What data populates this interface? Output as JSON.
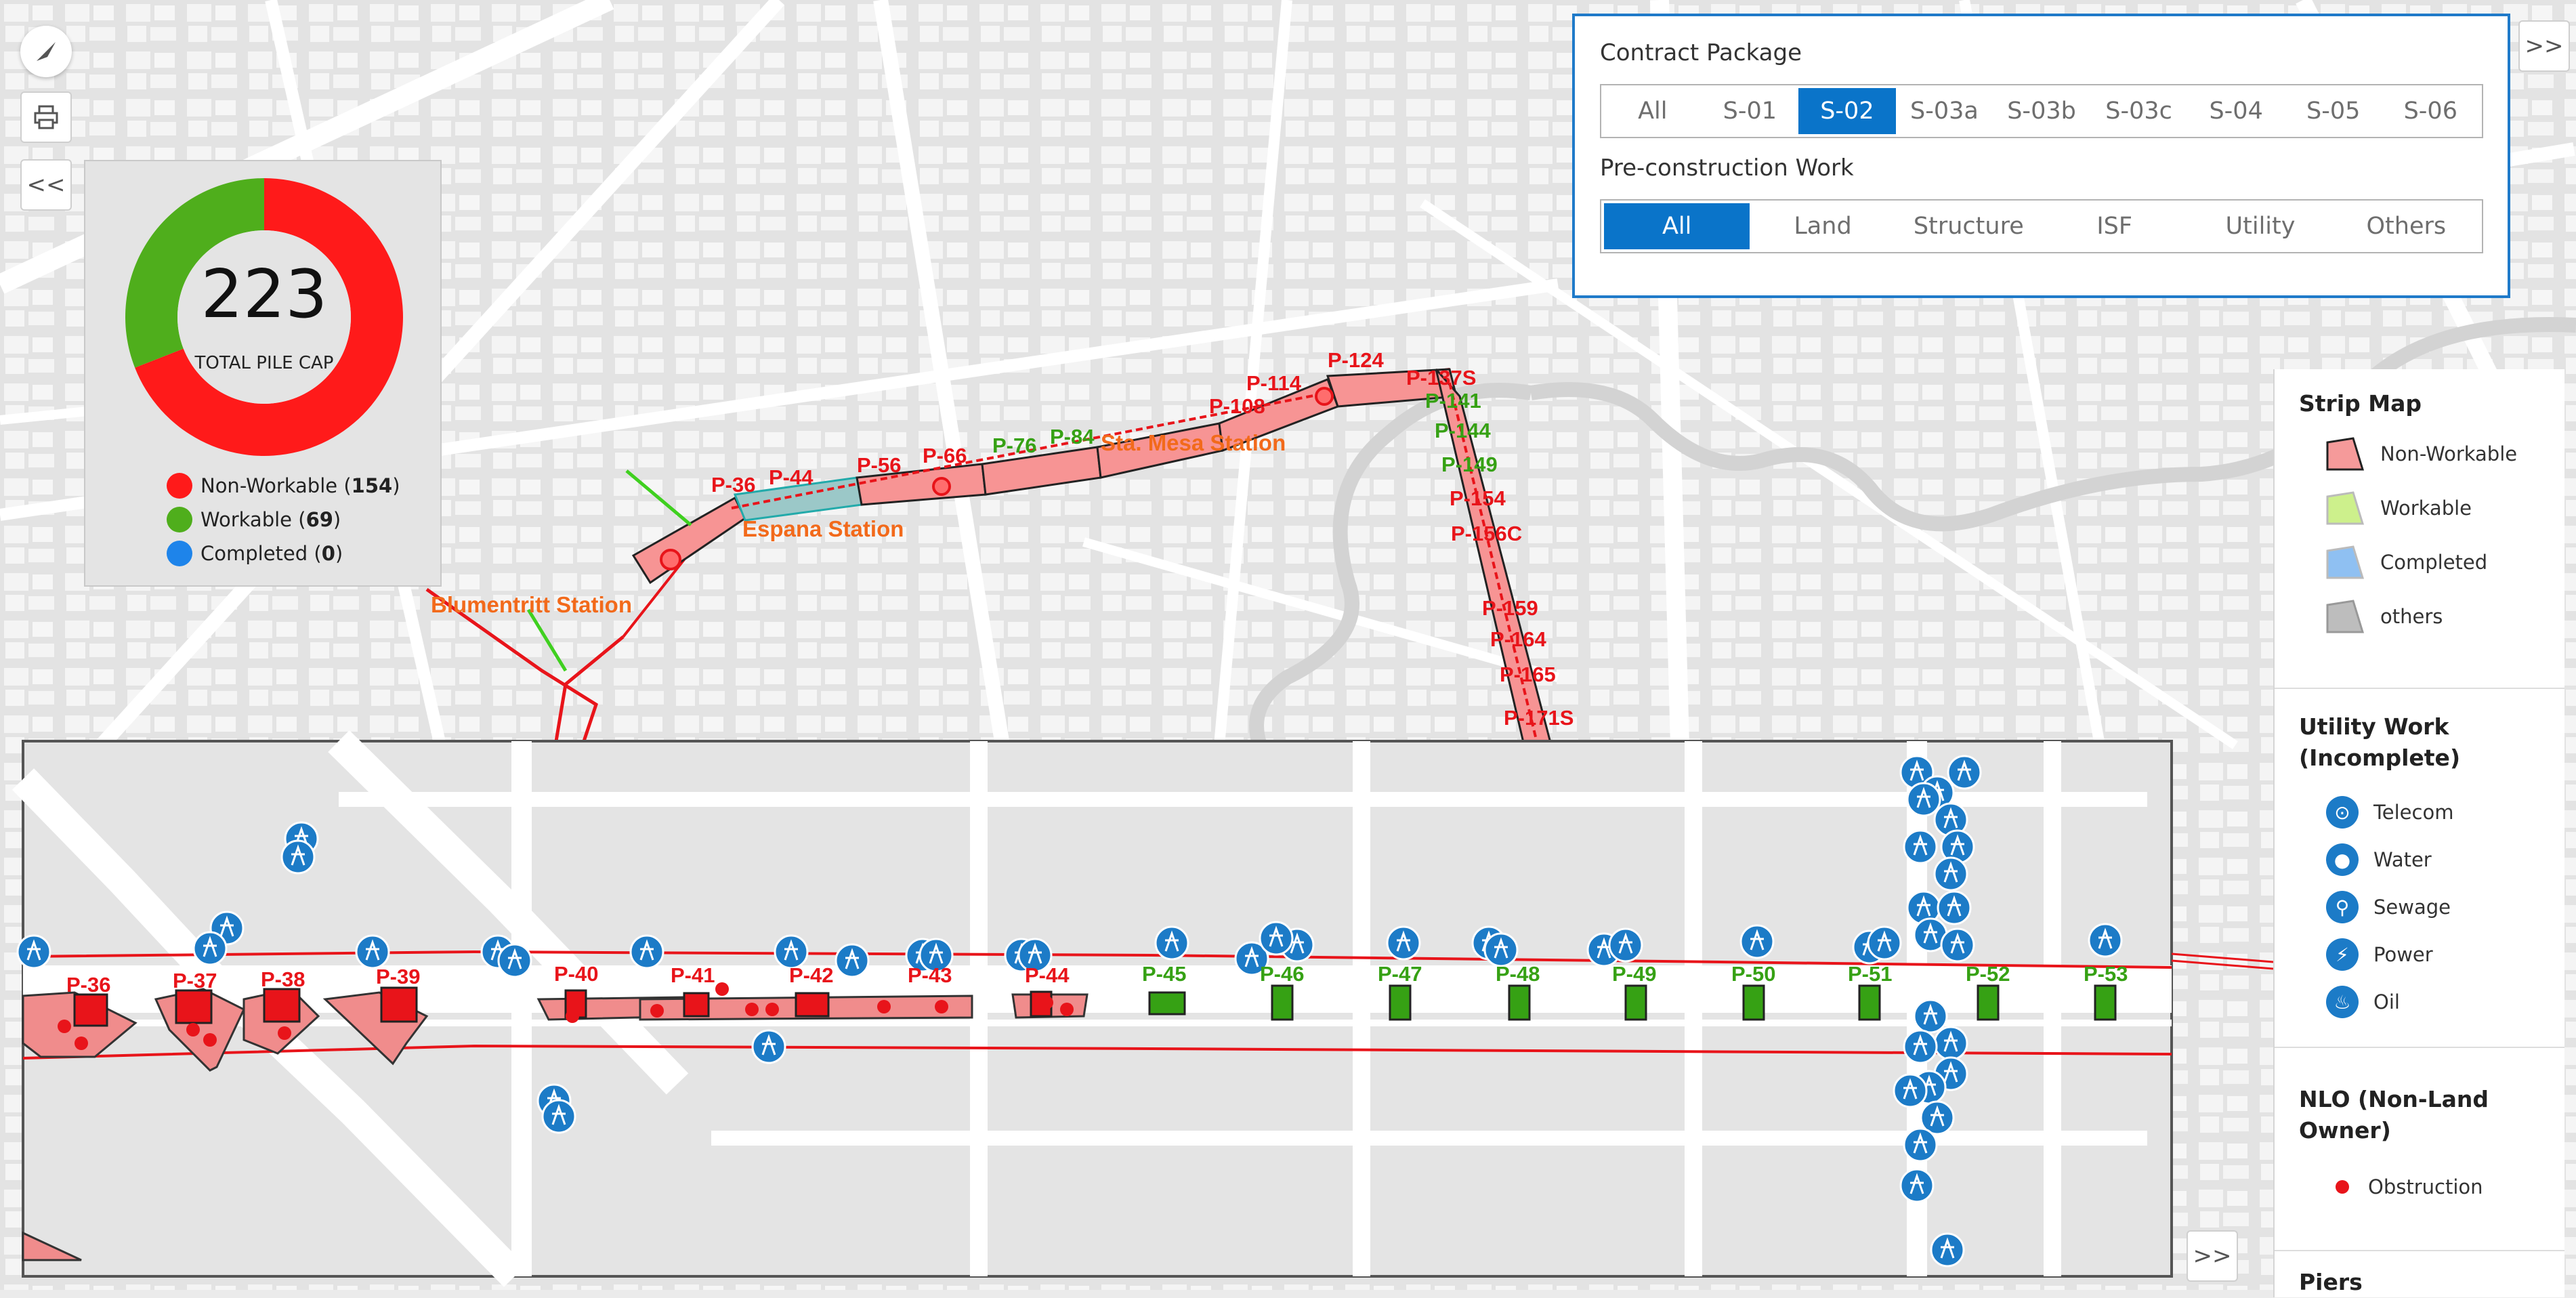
{
  "colors": {
    "nonworkable": "#ff1a1a",
    "workable": "#4fae1c",
    "completed": "#1e84ea",
    "accent": "#0a74c9",
    "station_text": "#f26a1b",
    "pier_red": "#e8141a",
    "pier_green": "#36a114"
  },
  "toolbar": {
    "compass_icon": "compass-icon",
    "print_icon": "printer-icon",
    "collapse_left_label": "<<",
    "expand_right_label": ">>",
    "expand_bottom_label": ">>"
  },
  "chart": {
    "total": "223",
    "total_label": "TOTAL PILE CAP",
    "chart_data": {
      "type": "pie",
      "categories": [
        "Non-Workable",
        "Workable",
        "Completed"
      ],
      "values": [
        154,
        69,
        0
      ],
      "colors": [
        "#ff1a1a",
        "#4fae1c",
        "#1e84ea"
      ]
    },
    "legend": [
      {
        "label": "Non-Workable",
        "count": "154",
        "color": "#ff1a1a"
      },
      {
        "label": "Workable",
        "count": "69",
        "color": "#4fae1c"
      },
      {
        "label": "Completed",
        "count": "0",
        "color": "#1e84ea"
      }
    ]
  },
  "filters": {
    "contract_title": "Contract Package",
    "contract_options": [
      "All",
      "S-01",
      "S-02",
      "S-03a",
      "S-03b",
      "S-03c",
      "S-04",
      "S-05",
      "S-06"
    ],
    "contract_selected": "S-02",
    "work_title": "Pre-construction Work",
    "work_options": [
      "All",
      "Land",
      "Structure",
      "ISF",
      "Utility",
      "Others"
    ],
    "work_selected": "All"
  },
  "map": {
    "stations": [
      "Blumentritt Station",
      "Espana Station",
      "Sta. Mesa Station"
    ],
    "upper_piers_red": [
      "P-36",
      "P-44",
      "P-56",
      "P-66",
      "P-108",
      "P-114",
      "P-124",
      "P-137S",
      "P-154",
      "P-156C",
      "P-159",
      "P-164",
      "P-165",
      "P-171S"
    ],
    "upper_piers_green": [
      "P-76",
      "P-84",
      "P-141",
      "P-144",
      "P-149"
    ],
    "strip_piers_red": [
      "P-36",
      "P-37",
      "P-38",
      "P-39",
      "P-40",
      "P-41",
      "P-42",
      "P-43",
      "P-44"
    ],
    "strip_piers_green": [
      "P-45",
      "P-46",
      "P-47",
      "P-48",
      "P-49",
      "P-50",
      "P-51",
      "P-52",
      "P-53"
    ]
  },
  "legend": {
    "strip_title": "Strip Map",
    "strip_items": [
      {
        "label": "Non-Workable",
        "fill": "#f59a9a",
        "stroke": "#222"
      },
      {
        "label": "Workable",
        "fill": "#cdf08c",
        "stroke": "#bbb"
      },
      {
        "label": "Completed",
        "fill": "#8fc0f2",
        "stroke": "#bbb"
      },
      {
        "label": "others",
        "fill": "#bdbdbd",
        "stroke": "#999"
      }
    ],
    "utility_title": "Utility Work (Incomplete)",
    "utility_items": [
      {
        "label": "Telecom",
        "icon": "telecom-icon"
      },
      {
        "label": "Water",
        "icon": "water-drop-icon"
      },
      {
        "label": "Sewage",
        "icon": "faucet-icon"
      },
      {
        "label": "Power",
        "icon": "power-tower-icon"
      },
      {
        "label": "Oil",
        "icon": "flame-icon"
      }
    ],
    "nlo_title": "NLO (Non-Land Owner)",
    "nlo_items": [
      {
        "label": "Obstruction",
        "color": "#e8141a"
      }
    ],
    "piers_title": "Piers"
  }
}
